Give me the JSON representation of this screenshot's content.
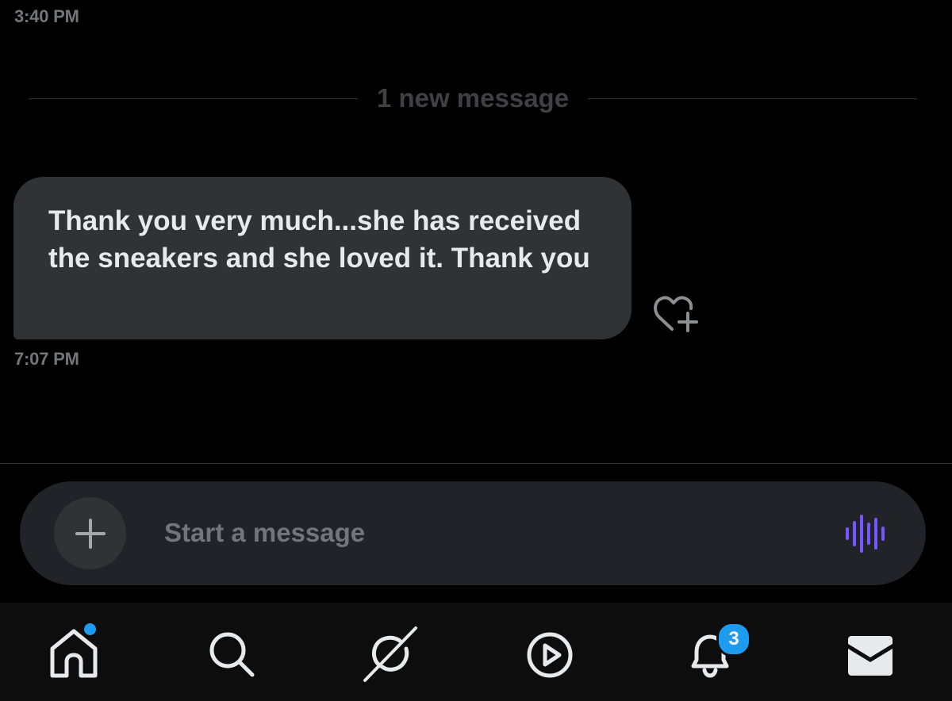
{
  "conversation": {
    "earlier_timestamp": "3:40 PM",
    "new_messages_divider": "1 new message",
    "messages": [
      {
        "text": "Thank you very much...she has received the sneakers and she loved it. Thank you",
        "timestamp": "7:07 PM",
        "reaction_icon": "heart-plus-icon"
      }
    ]
  },
  "composer": {
    "add_icon": "plus-icon",
    "placeholder": "Start a message",
    "value": "",
    "voice_icon": "voice-waveform-icon"
  },
  "tabbar": {
    "tabs": [
      {
        "name": "home",
        "icon": "home-icon",
        "has_dot": true
      },
      {
        "name": "search",
        "icon": "search-icon"
      },
      {
        "name": "grok",
        "icon": "grok-icon"
      },
      {
        "name": "video",
        "icon": "play-circle-icon"
      },
      {
        "name": "notifications",
        "icon": "bell-icon",
        "badge": "3"
      },
      {
        "name": "messages",
        "icon": "envelope-icon"
      }
    ]
  },
  "colors": {
    "background": "#000000",
    "bubble": "#2f3336",
    "composer": "#202327",
    "accent_blue": "#1d9bf0",
    "voice_purple": "#7856ff",
    "muted_text": "#71767b"
  }
}
